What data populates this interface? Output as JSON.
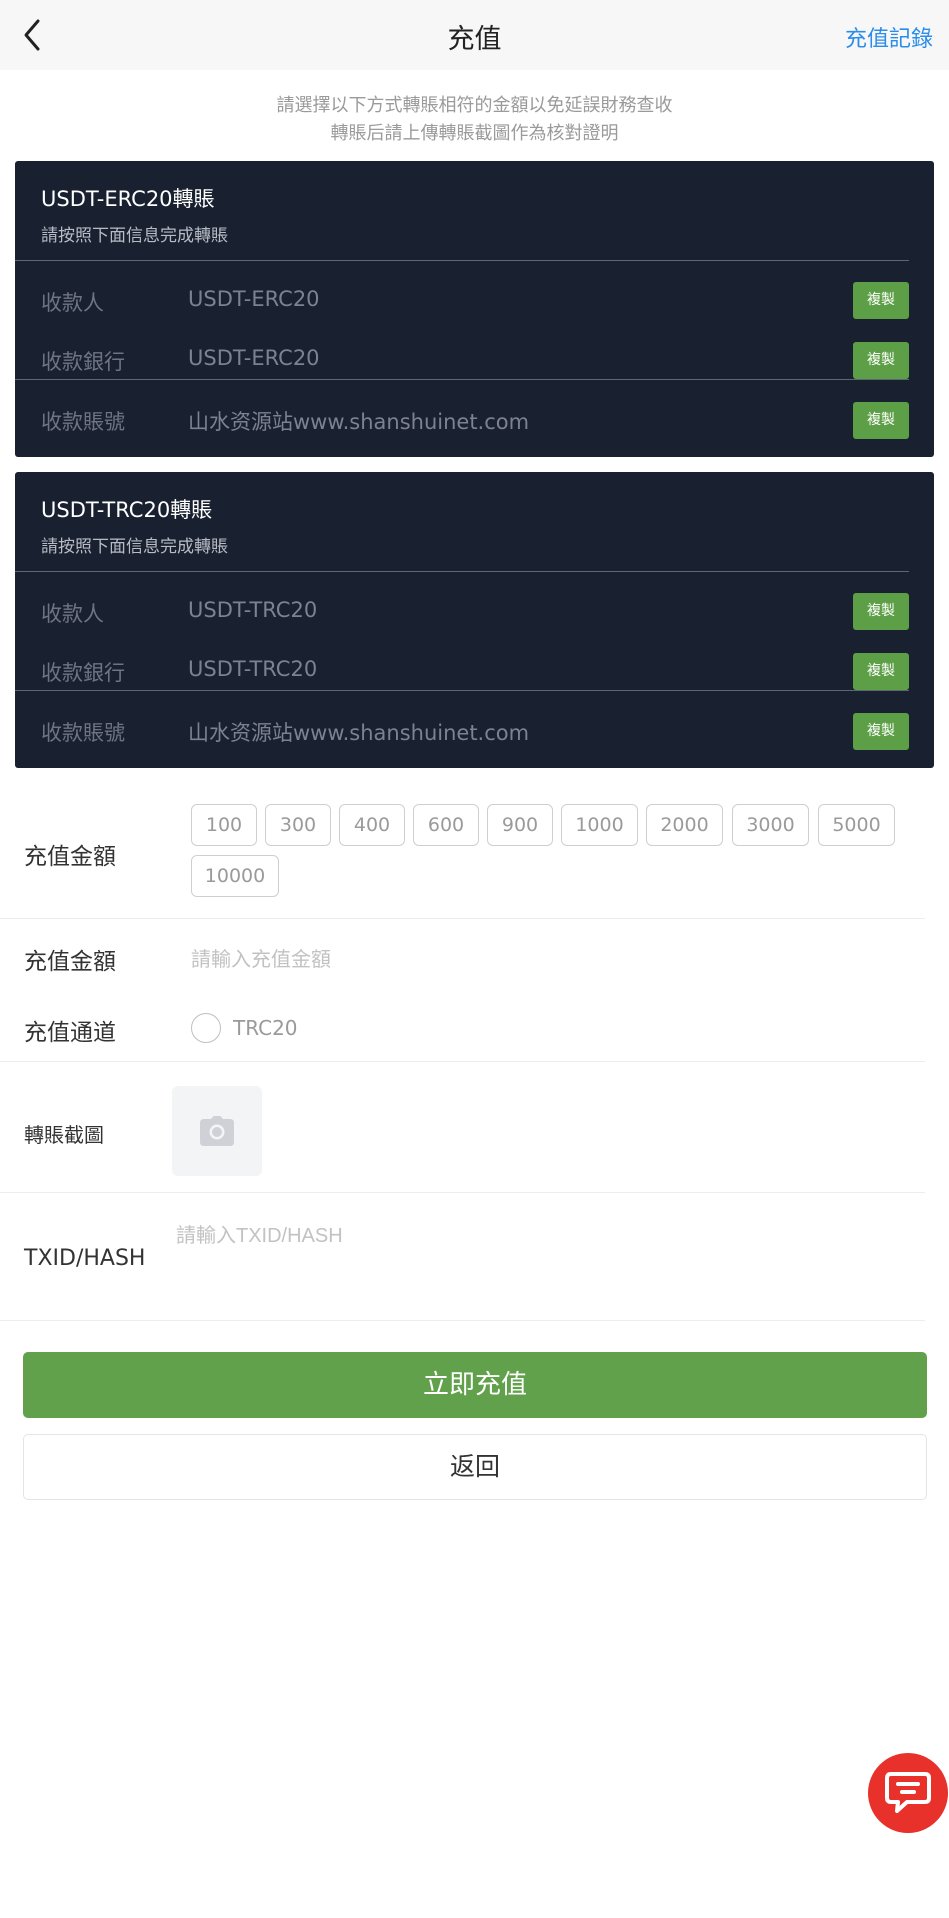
{
  "header": {
    "title": "充值",
    "records_label": "充值記錄",
    "back_icon": "chevron-left-icon"
  },
  "notice": {
    "line1": "請選擇以下方式轉賬相符的金額以免延誤財務查收",
    "line2": "轉賬后請上傳轉賬截圖作為核對證明"
  },
  "cards": [
    {
      "title": "USDT-ERC20轉賬",
      "subtitle": "請按照下面信息完成轉賬",
      "rows": [
        {
          "label": "收款人",
          "value": "USDT-ERC20",
          "copy": "複製"
        },
        {
          "label": "收款銀行",
          "value": "USDT-ERC20",
          "copy": "複製"
        },
        {
          "label": "收款賬號",
          "value": "山水资源站www.shanshuinet.com",
          "copy": "複製"
        }
      ]
    },
    {
      "title": "USDT-TRC20轉賬",
      "subtitle": "請按照下面信息完成轉賬",
      "rows": [
        {
          "label": "收款人",
          "value": "USDT-TRC20",
          "copy": "複製"
        },
        {
          "label": "收款銀行",
          "value": "USDT-TRC20",
          "copy": "複製"
        },
        {
          "label": "收款賬號",
          "value": "山水资源站www.shanshuinet.com",
          "copy": "複製"
        }
      ]
    }
  ],
  "amount_presets": {
    "label": "充值金額",
    "options": [
      "100",
      "300",
      "400",
      "600",
      "900",
      "1000",
      "2000",
      "3000",
      "5000",
      "10000"
    ]
  },
  "amount_input": {
    "label": "充值金額",
    "placeholder": "請輸入充值金額",
    "value": ""
  },
  "channel": {
    "label": "充值通道",
    "option": "TRC20",
    "selected": false
  },
  "screenshot": {
    "label": "轉賬截圖",
    "icon": "camera-icon"
  },
  "txid": {
    "label": "TXID/HASH",
    "placeholder": "請輸入TXID/HASH",
    "value": ""
  },
  "actions": {
    "submit_label": "立即充值",
    "return_label": "返回"
  },
  "chat": {
    "icon": "chat-icon"
  },
  "colors": {
    "accent_blue": "#2b8de8",
    "card_bg": "#19202f",
    "green": "#62a14b",
    "chat_red": "#e8312a"
  }
}
